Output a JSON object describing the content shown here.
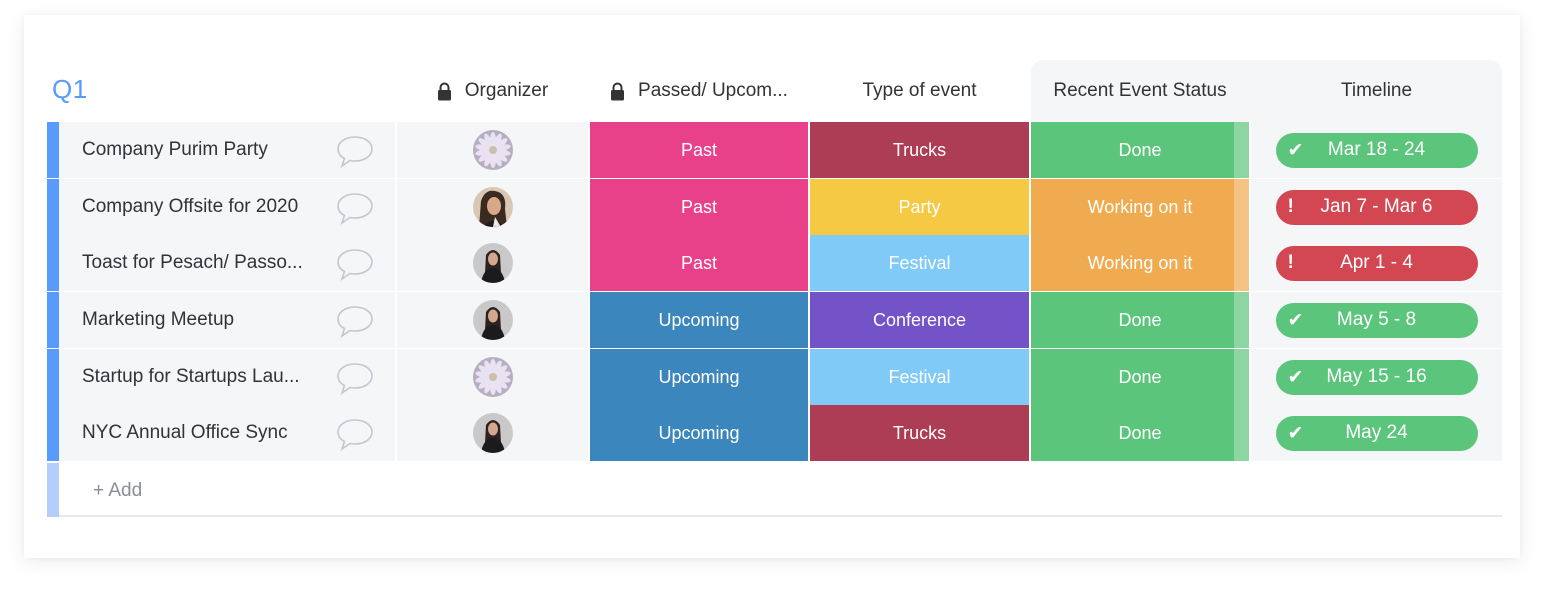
{
  "group": {
    "title": "Q1",
    "color": "#579bfc"
  },
  "columns": {
    "organizer": {
      "label": "Organizer",
      "icon": "lock-icon"
    },
    "passed": {
      "label": "Passed/ Upcom...",
      "icon": "lock-icon"
    },
    "type": {
      "label": "Type of event"
    },
    "status": {
      "label": "Recent Event Status"
    },
    "timeline": {
      "label": "Timeline"
    }
  },
  "colors": {
    "past": "#e8418a",
    "upcoming": "#3a86bd",
    "trucks": "#ad3d54",
    "party": "#f6c944",
    "festival": "#7fcaf7",
    "conference": "#7452c7",
    "done": "#5cc57c",
    "working": "#f0ab50",
    "timeline_ok": "#5cc57c",
    "timeline_overdue": "#d34752"
  },
  "rows": [
    {
      "name": "Company Purim Party",
      "organizer_avatar": "flower",
      "passed": "Past",
      "passed_key": "past",
      "type": "Trucks",
      "type_key": "trucks",
      "status": "Done",
      "status_key": "done",
      "timeline": "Mar 18 - 24",
      "timeline_state": "ok",
      "timeline_icon": "✔"
    },
    {
      "name": "Company Offsite for 2020",
      "organizer_avatar": "woman-photo",
      "passed": "Past",
      "passed_key": "past",
      "type": "Party",
      "type_key": "party",
      "status": "Working on it",
      "status_key": "working",
      "timeline": "Jan 7 - Mar 6",
      "timeline_state": "overdue",
      "timeline_icon": "!"
    },
    {
      "name": "Toast for Pesach/ Passo...",
      "organizer_avatar": "person-dark",
      "passed": "Past",
      "passed_key": "past",
      "type": "Festival",
      "type_key": "festival",
      "status": "Working on it",
      "status_key": "working",
      "timeline": "Apr 1 - 4",
      "timeline_state": "overdue",
      "timeline_icon": "!"
    },
    {
      "name": "Marketing Meetup",
      "organizer_avatar": "person-dark",
      "passed": "Upcoming",
      "passed_key": "upcoming",
      "type": "Conference",
      "type_key": "conference",
      "status": "Done",
      "status_key": "done",
      "timeline": "May 5 - 8",
      "timeline_state": "ok",
      "timeline_icon": "✔"
    },
    {
      "name": "Startup for Startups Lau...",
      "organizer_avatar": "flower",
      "passed": "Upcoming",
      "passed_key": "upcoming",
      "type": "Festival",
      "type_key": "festival",
      "status": "Done",
      "status_key": "done",
      "timeline": "May 15 - 16",
      "timeline_state": "ok",
      "timeline_icon": "✔"
    },
    {
      "name": "NYC Annual Office Sync",
      "organizer_avatar": "person-dark",
      "passed": "Upcoming",
      "passed_key": "upcoming",
      "type": "Trucks",
      "type_key": "trucks",
      "status": "Done",
      "status_key": "done",
      "timeline": "May 24",
      "timeline_state": "ok",
      "timeline_icon": "✔"
    }
  ],
  "add_row": {
    "label": "+ Add"
  }
}
